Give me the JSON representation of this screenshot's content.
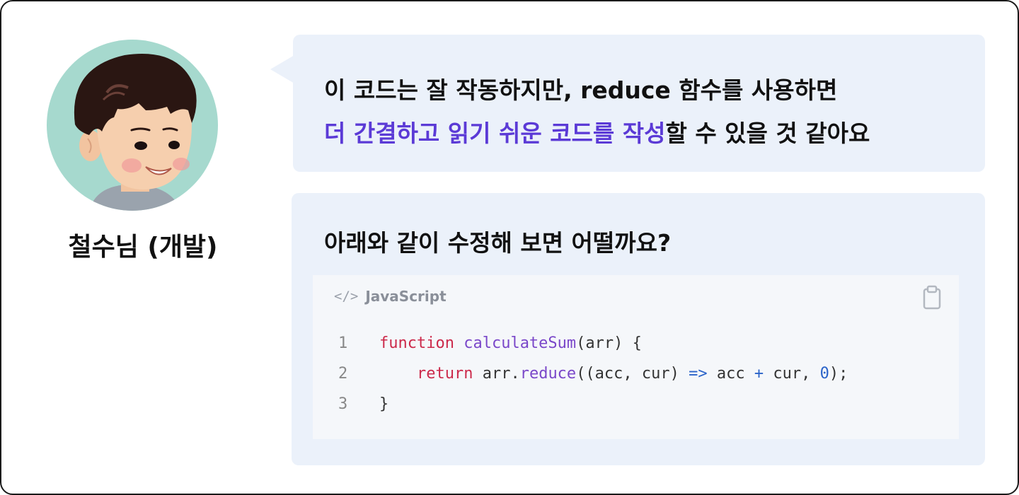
{
  "user": {
    "name": "철수님 (개발)"
  },
  "message": {
    "line1": "이 코드는 잘 작동하지만, reduce 함수를 사용하면",
    "line2_highlight": "더 간결하고 읽기 쉬운 코드를 작성",
    "line2_rest": "할 수 있을 것 같아요"
  },
  "suggestion": {
    "title": "아래와 같이 수정해 보면 어떨까요?",
    "code_block": {
      "language_icon": "</>",
      "language": "JavaScript",
      "copy_icon": "clipboard-icon",
      "lines": [
        {
          "num": "1",
          "tokens": [
            {
              "t": "function",
              "c": "kw"
            },
            {
              "t": " ",
              "c": ""
            },
            {
              "t": "calculateSum",
              "c": "fn"
            },
            {
              "t": "(arr) {",
              "c": ""
            }
          ]
        },
        {
          "num": "2",
          "tokens": [
            {
              "t": "    ",
              "c": ""
            },
            {
              "t": "return",
              "c": "kw"
            },
            {
              "t": " arr.",
              "c": ""
            },
            {
              "t": "reduce",
              "c": "fn"
            },
            {
              "t": "((acc, cur) ",
              "c": ""
            },
            {
              "t": "=>",
              "c": "op"
            },
            {
              "t": " acc ",
              "c": ""
            },
            {
              "t": "+",
              "c": "op"
            },
            {
              "t": " cur, ",
              "c": ""
            },
            {
              "t": "0",
              "c": "num"
            },
            {
              "t": ");",
              "c": ""
            }
          ]
        },
        {
          "num": "3",
          "tokens": [
            {
              "t": "}",
              "c": ""
            }
          ]
        }
      ]
    }
  },
  "colors": {
    "bubble_bg": "#ebf1fa",
    "highlight": "#5b3ad6",
    "avatar_bg": "#a6d9ce",
    "keyword": "#cc2a4b",
    "function": "#7a47c9",
    "operator": "#2a63c9"
  }
}
